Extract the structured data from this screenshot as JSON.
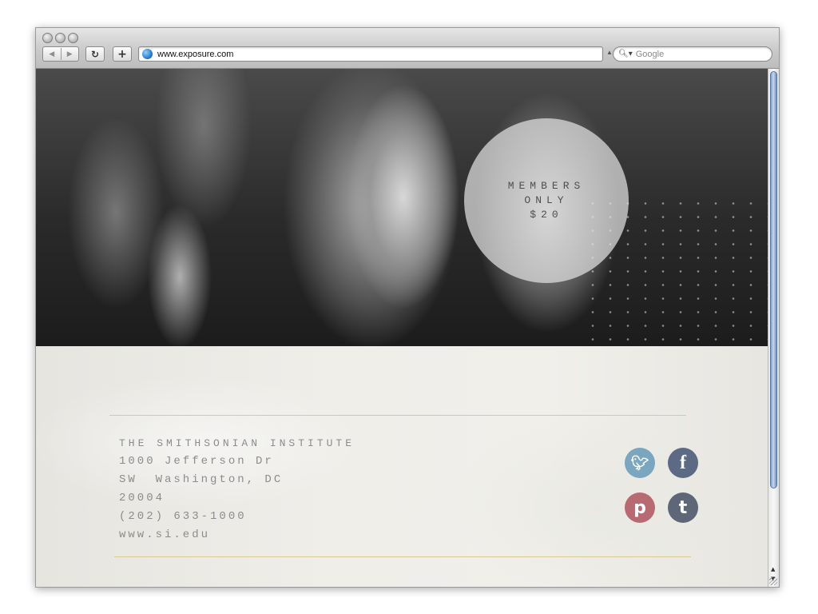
{
  "browser": {
    "url": "www.exposure.com",
    "search_placeholder": "Google",
    "back_glyph": "◀",
    "forward_glyph": "▶",
    "reload_glyph": "↻",
    "add_glyph": "+",
    "search_glyph": "🔍︎▾",
    "url_caret": "▲"
  },
  "hero": {
    "badge_lines": [
      "MEMBERS",
      "ONLY",
      "$20"
    ]
  },
  "footer": {
    "address_lines": [
      "THE SMITHSONIAN INSTITUTE",
      "1000 Jefferson Dr",
      "SW  Washington, DC",
      "20004",
      "(202) 633-1000",
      "www.si.edu"
    ],
    "social": [
      {
        "name": "twitter-icon",
        "glyph": "🐦︎",
        "color": "#7aa6bf"
      },
      {
        "name": "facebook-icon",
        "glyph": "f",
        "color": "#5c6a84"
      },
      {
        "name": "pinterest-icon",
        "glyph": "p",
        "color": "#b86a73"
      },
      {
        "name": "tumblr-icon",
        "glyph": "t",
        "color": "#5e6777"
      }
    ]
  },
  "scrollbar": {
    "up_glyph": "▲",
    "down_glyph": "▼"
  }
}
